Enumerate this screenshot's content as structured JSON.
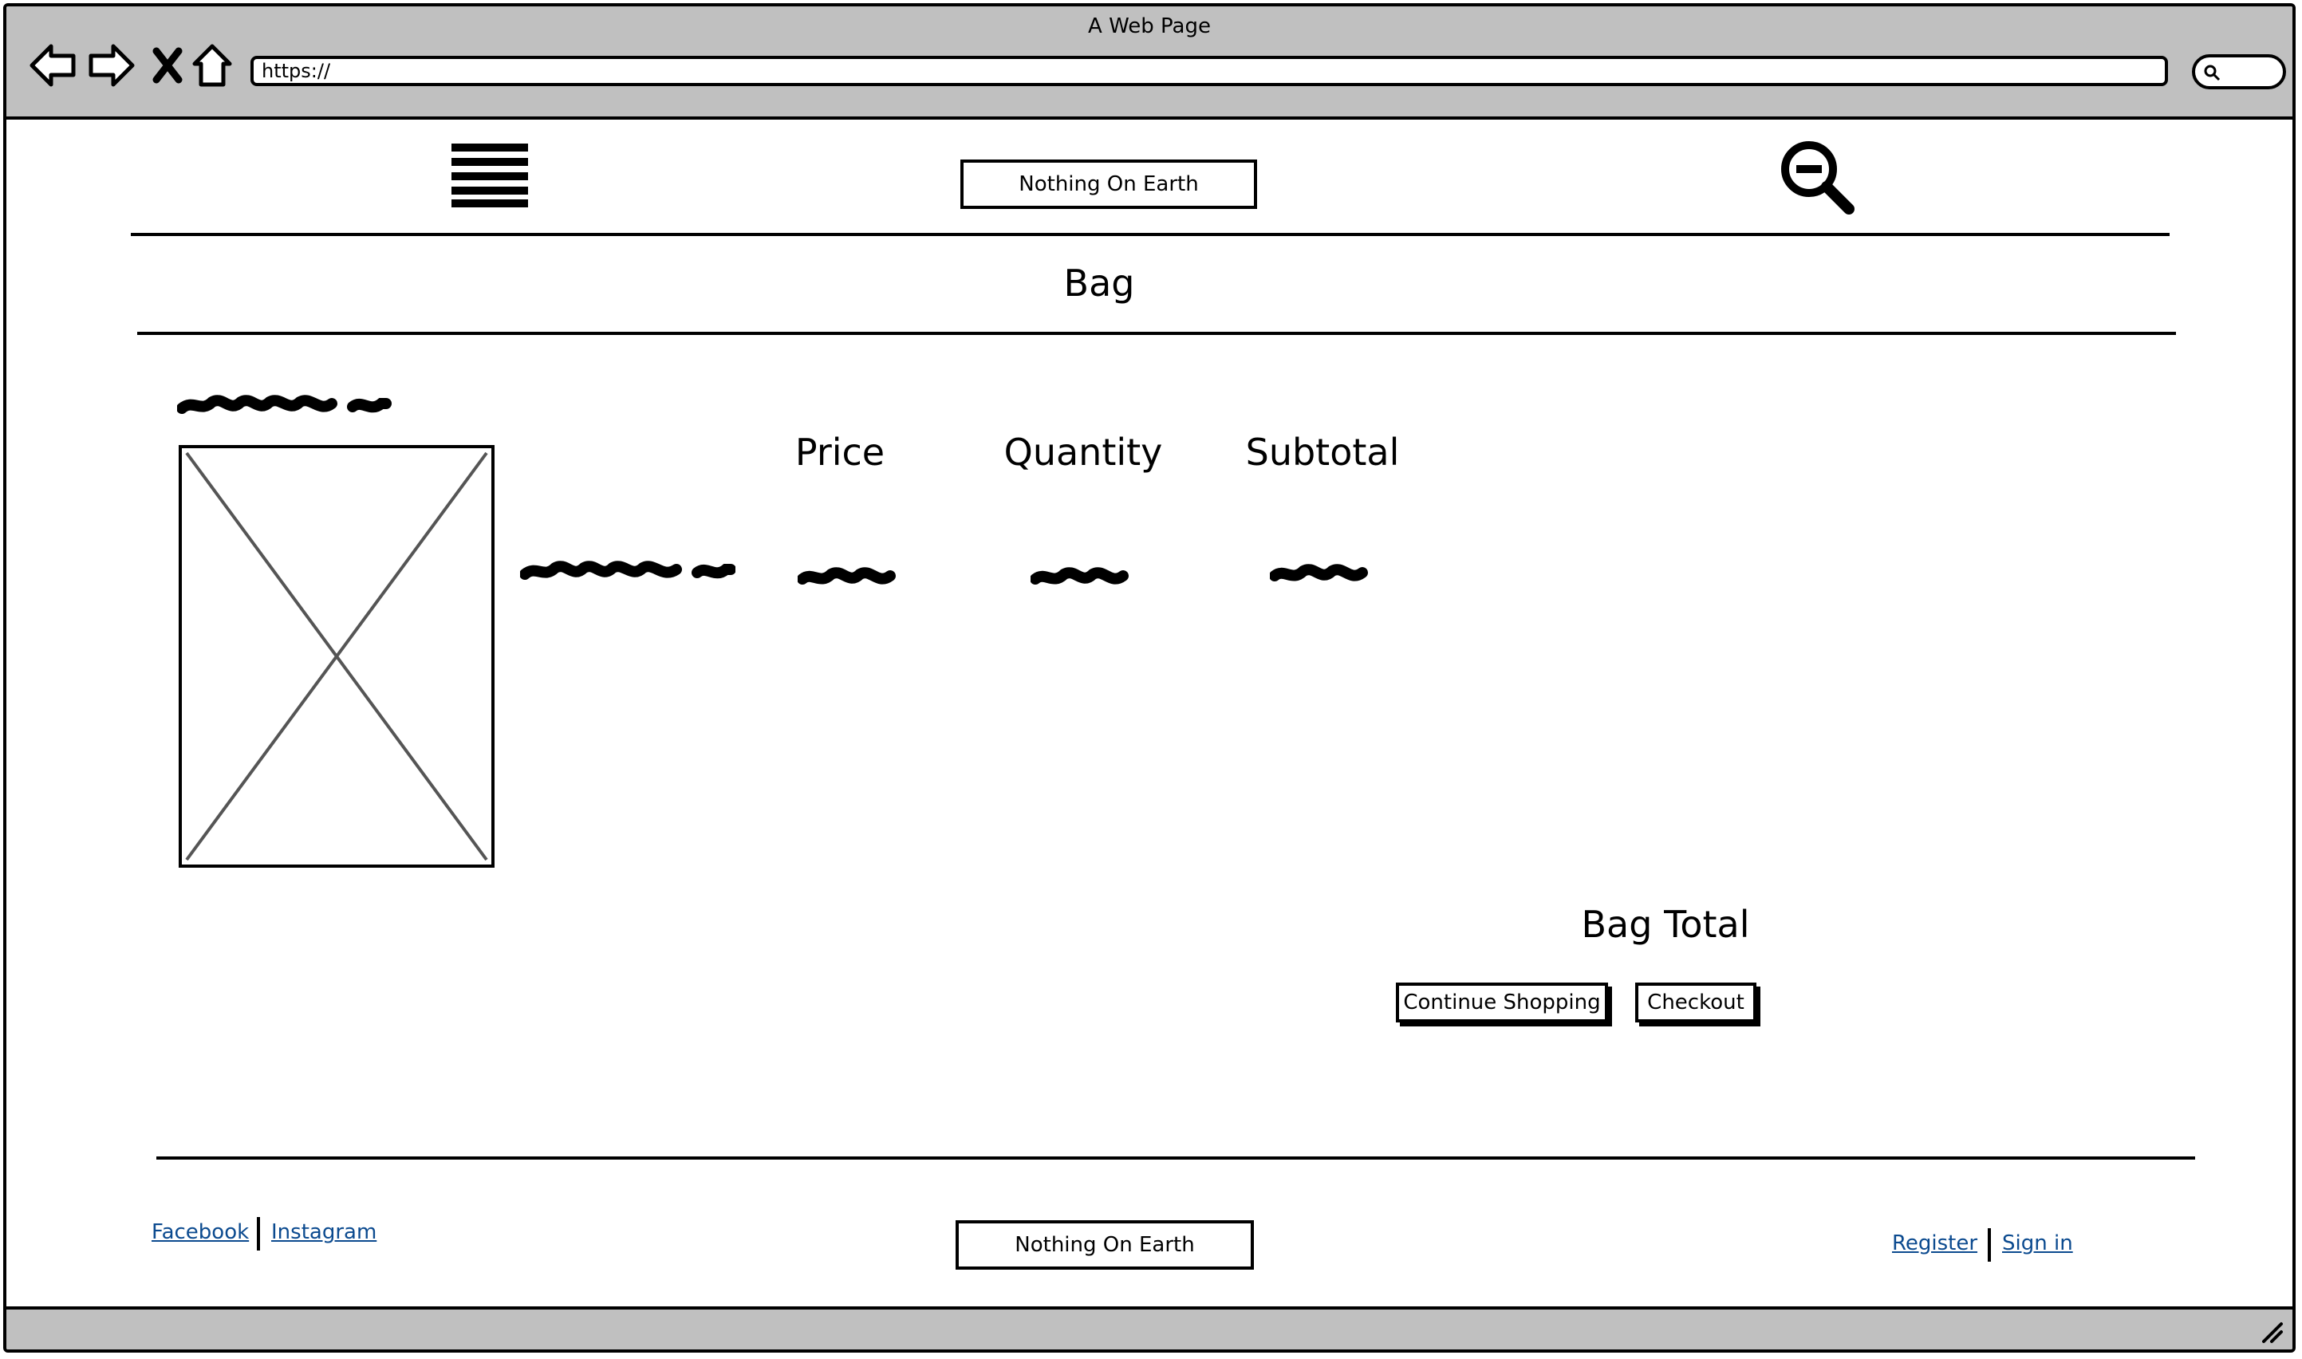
{
  "browser": {
    "window_title": "A Web Page",
    "url": "https://",
    "nav_icons": [
      "back-arrow-icon",
      "forward-arrow-icon",
      "close-icon",
      "home-icon"
    ],
    "search_icon": "search-icon"
  },
  "header": {
    "menu_icon": "hamburger-menu-icon",
    "logo_text": "Nothing On Earth",
    "zoom_icon": "zoom-out-icon"
  },
  "page": {
    "heading": "Bag"
  },
  "bag_table": {
    "columns": [
      "Price",
      "Quantity",
      "Subtotal"
    ]
  },
  "summary": {
    "total_label": "Bag Total",
    "continue_label": "Continue Shopping",
    "checkout_label": "Checkout"
  },
  "footer": {
    "social_links": [
      "Facebook",
      "Instagram"
    ],
    "logo_text": "Nothing On Earth",
    "account_links": [
      "Register",
      "Sign in"
    ]
  },
  "colors": {
    "chrome_gray": "#c0c0c0",
    "link_blue": "#0b4a8f"
  }
}
